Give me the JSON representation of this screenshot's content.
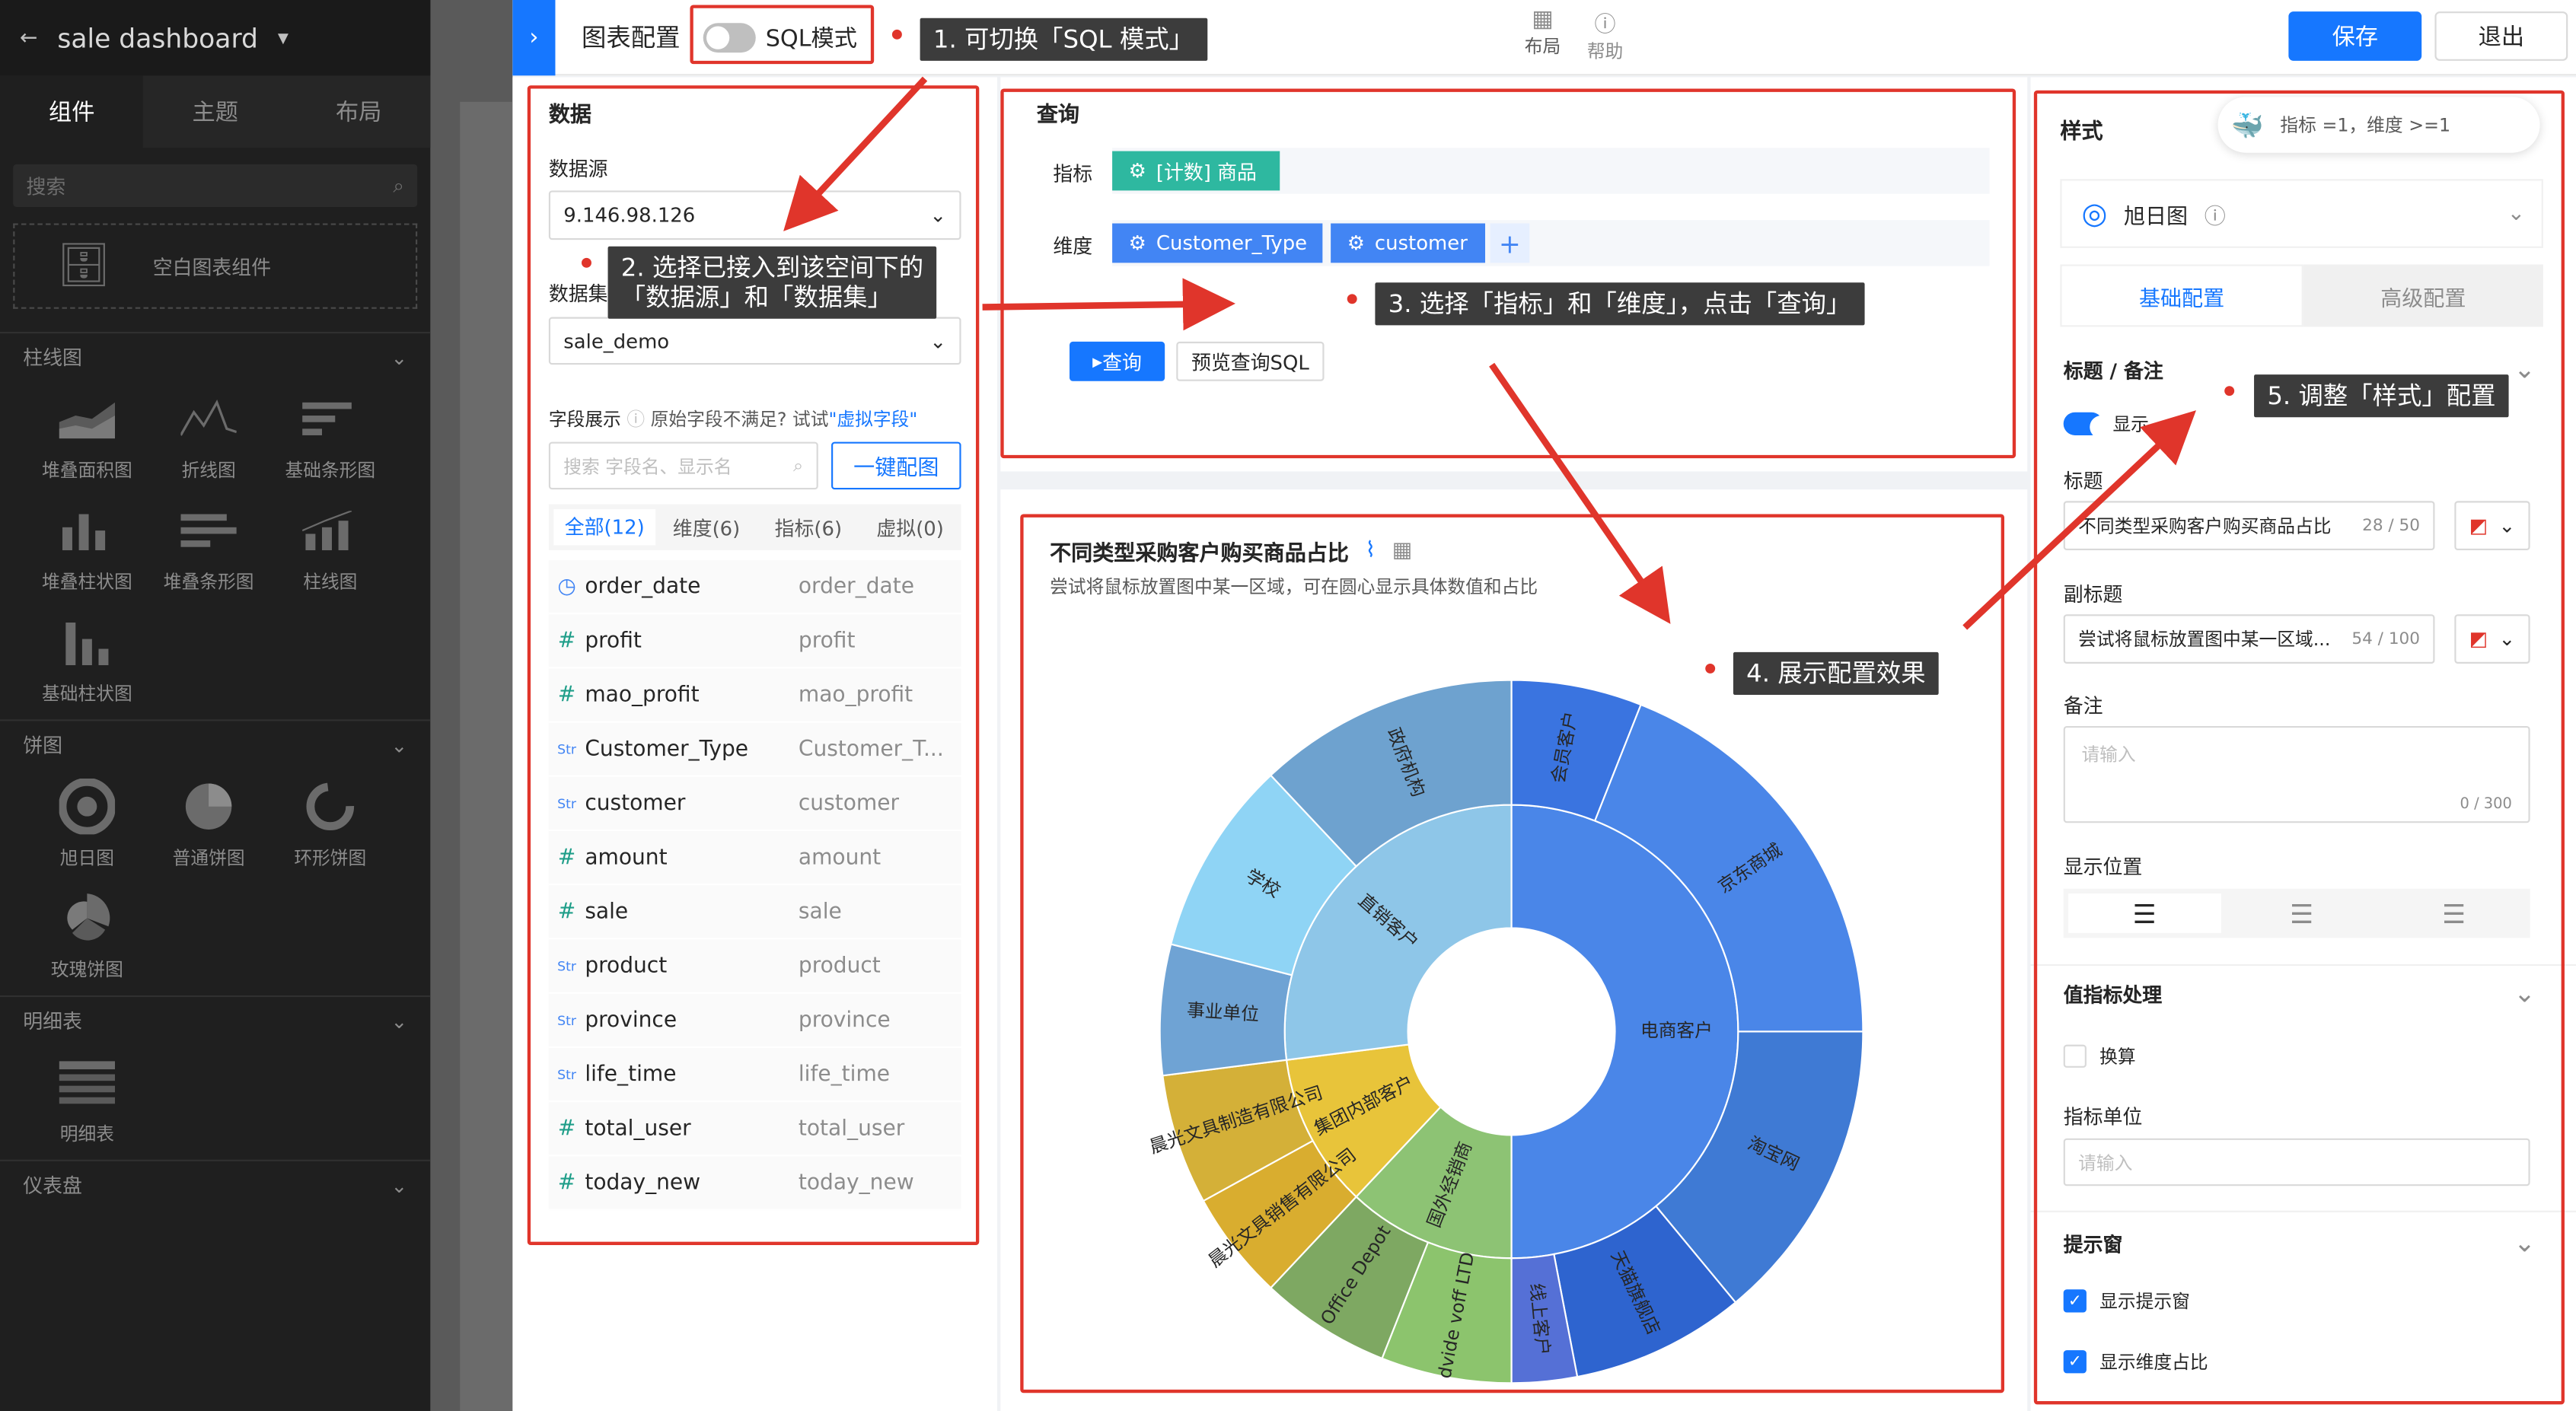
{
  "app": {
    "dashboard_name": "sale dashboard"
  },
  "left_sidebar": {
    "tabs": [
      "组件",
      "主题",
      "布局"
    ],
    "search_placeholder": "搜索",
    "empty_component": "空白图表组件",
    "sections": [
      {
        "title": "柱线图",
        "items": [
          "堆叠面积图",
          "折线图",
          "基础条形图",
          "堆叠柱状图",
          "堆叠条形图",
          "柱线图",
          "基础柱状图"
        ]
      },
      {
        "title": "饼图",
        "items": [
          "旭日图",
          "普通饼图",
          "环形饼图",
          "玫瑰饼图"
        ]
      },
      {
        "title": "明细表",
        "items": [
          "明细表"
        ]
      },
      {
        "title": "仪表盘",
        "items": []
      }
    ]
  },
  "header": {
    "title": "图表配置",
    "sql_mode_label": "SQL模式",
    "layout_label": "布局",
    "help_label": "帮助",
    "save_label": "保存",
    "exit_label": "退出"
  },
  "data_panel": {
    "title": "数据",
    "datasource_label": "数据源",
    "datasource_value": "9.146.98.126",
    "dataset_label": "数据集",
    "dataset_value": "sale_demo",
    "field_display_label": "字段展示",
    "field_hint": "原始字段不满足? 试试",
    "virtual_field_link": "\"虚拟字段\"",
    "field_search_placeholder": "搜索 字段名、显示名",
    "auto_config_button": "一键配图",
    "filter_tabs": [
      "全部(12)",
      "维度(6)",
      "指标(6)",
      "虚拟(0)"
    ],
    "fields": [
      {
        "type": "time",
        "name": "order_date",
        "alias": "order_date"
      },
      {
        "type": "#",
        "name": "profit",
        "alias": "profit"
      },
      {
        "type": "#",
        "name": "mao_profit",
        "alias": "mao_profit"
      },
      {
        "type": "Str",
        "name": "Customer_Type",
        "alias": "Customer_T..."
      },
      {
        "type": "Str",
        "name": "customer",
        "alias": "customer"
      },
      {
        "type": "#",
        "name": "amount",
        "alias": "amount"
      },
      {
        "type": "#",
        "name": "sale",
        "alias": "sale"
      },
      {
        "type": "Str",
        "name": "product",
        "alias": "product"
      },
      {
        "type": "Str",
        "name": "province",
        "alias": "province"
      },
      {
        "type": "Str",
        "name": "life_time",
        "alias": "life_time"
      },
      {
        "type": "#",
        "name": "total_user",
        "alias": "total_user"
      },
      {
        "type": "#",
        "name": "today_new",
        "alias": "today_new"
      }
    ]
  },
  "query_panel": {
    "title": "查询",
    "metric_label": "指标",
    "metric_tag": "[计数] 商品",
    "dimension_label": "维度",
    "dimension_tags": [
      "Customer_Type",
      "customer"
    ],
    "query_button": "查询",
    "preview_sql_button": "预览查询SQL"
  },
  "chart_panel": {
    "title": "不同类型采购客户购买商品占比",
    "subtitle": "尝试将鼠标放置图中某一区域，可在圆心显示具体数值和占比"
  },
  "chart_data": {
    "type": "sunburst",
    "inner": [
      {
        "name": "电商客户",
        "value": 50,
        "color": "#4a86e8"
      },
      {
        "name": "国外经销商",
        "value": 12,
        "color": "#8dc374"
      },
      {
        "name": "集团内部客户",
        "value": 11,
        "color": "#e8c43a"
      },
      {
        "name": "直销客户",
        "value": 27,
        "color": "#8ec6e8"
      }
    ],
    "outer": [
      {
        "name": "会员客户",
        "parent": "电商客户",
        "value": 6,
        "color": "#3a74e0"
      },
      {
        "name": "京东商城",
        "parent": "电商客户",
        "value": 19,
        "color": "#4a86e8"
      },
      {
        "name": "淘宝网",
        "parent": "电商客户",
        "value": 14,
        "color": "#3f7ad4"
      },
      {
        "name": "天猫旗舰店",
        "parent": "电商客户",
        "value": 8,
        "color": "#2e64cf"
      },
      {
        "name": "线上客户",
        "parent": "电商客户",
        "value": 3,
        "color": "#5570d6"
      },
      {
        "name": "dvide voff LTD",
        "parent": "国外经销商",
        "value": 6,
        "color": "#8cc46d"
      },
      {
        "name": "Office Depot",
        "parent": "国外经销商",
        "value": 6,
        "color": "#7ea862"
      },
      {
        "name": "晨光文具销售有限公司",
        "parent": "集团内部客户",
        "value": 5,
        "color": "#d9ad2f"
      },
      {
        "name": "晨光文具制造有限公司",
        "parent": "集团内部客户",
        "value": 6,
        "color": "#d4b038"
      },
      {
        "name": "事业单位",
        "parent": "直销客户",
        "value": 6,
        "color": "#6fa3d4"
      },
      {
        "name": "学校",
        "parent": "直销客户",
        "value": 9,
        "color": "#8fd4f5"
      },
      {
        "name": "政府机构",
        "parent": "直销客户",
        "value": 12,
        "color": "#6ea2cf"
      }
    ]
  },
  "style_panel": {
    "title": "样式",
    "bubble_text": "指标 =1，维度 >=1",
    "chart_type": "旭日图",
    "tabs": [
      "基础配置",
      "高级配置"
    ],
    "title_note_section": "标题 / 备注",
    "show_label": "显示",
    "title_label": "标题",
    "title_value": "不同类型采购客户购买商品占比",
    "title_count": "28 / 50",
    "subtitle_label": "副标题",
    "subtitle_value": "尝试将鼠标放置图中某一区域...",
    "subtitle_count": "54 / 100",
    "note_label": "备注",
    "note_placeholder": "请输入",
    "note_count": "0 / 300",
    "position_label": "显示位置",
    "value_section": "值指标处理",
    "convert_label": "换算",
    "unit_label": "指标单位",
    "unit_placeholder": "请输入",
    "tooltip_section": "提示窗",
    "show_tooltip_label": "显示提示窗",
    "show_dim_ratio_label": "显示维度占比"
  },
  "annotations": {
    "n1": "1. 可切换「SQL 模式」",
    "n2a": "2. 选择已接入到该空间下的",
    "n2b": "「数据源」和「数据集」",
    "n3": "3. 选择「指标」和「维度」，点击「查询」",
    "n4": "4. 展示配置效果",
    "n5": "5. 调整「样式」配置"
  }
}
